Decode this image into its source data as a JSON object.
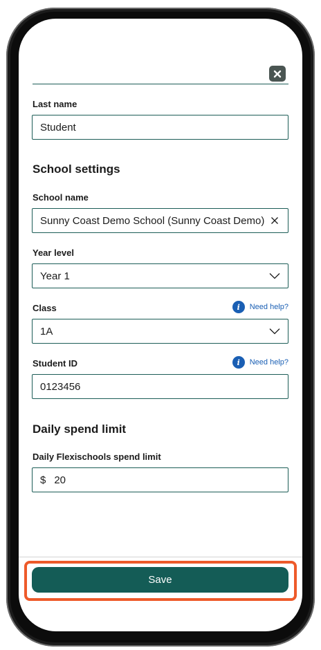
{
  "form": {
    "close_icon": "close-icon",
    "last_name": {
      "label": "Last name",
      "value": "Student"
    },
    "school_settings_heading": "School settings",
    "school_name": {
      "label": "School name",
      "value": "Sunny Coast Demo School (Sunny Coast Demo)"
    },
    "year_level": {
      "label": "Year level",
      "value": "Year 1"
    },
    "class": {
      "label": "Class",
      "value": "1A",
      "help": "Need help?"
    },
    "student_id": {
      "label": "Student ID",
      "value": "0123456",
      "help": "Need help?"
    },
    "spend_heading": "Daily spend limit",
    "spend_limit": {
      "label": "Daily Flexischools spend limit",
      "currency": "$",
      "value": "20"
    },
    "info_glyph": "i"
  },
  "footer": {
    "save_label": "Save"
  },
  "colors": {
    "accent": "#145c56",
    "link": "#1a5fb4",
    "highlight": "#ee5a2a"
  }
}
